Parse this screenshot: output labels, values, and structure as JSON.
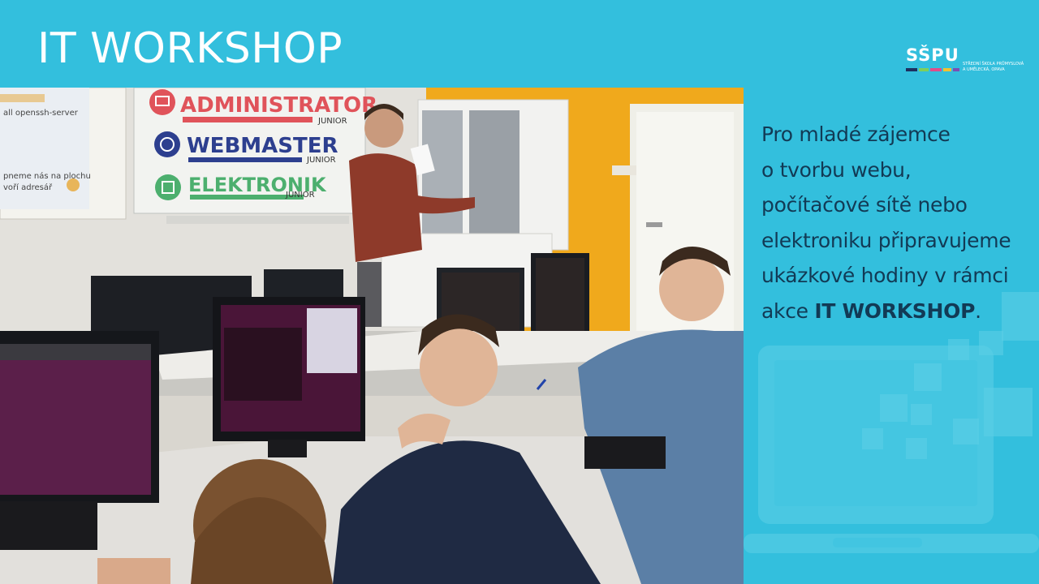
{
  "slide": {
    "title": "IT WORKSHOP"
  },
  "logo": {
    "mark": "SŠPU",
    "subtitle": "Střední škola průmyslová a umělecká, Opava"
  },
  "photo": {
    "banner_items": [
      "ADMINISTRATOR",
      "WEBMASTER",
      "ELEKTRONIK"
    ],
    "banner_sub": "JUNIOR",
    "projection_lines": [
      "all openssh-server",
      "pneme nás na plochu",
      "voří adresář"
    ]
  },
  "description": {
    "line1": "Pro mladé zájemce",
    "line2": "o tvorbu webu,",
    "line3": "počítačové sítě nebo",
    "line4": "elektroniku připravujeme",
    "line5": "ukázkové hodiny v rámci",
    "line6_prefix": "akce ",
    "line6_bold": "IT WORKSHOP",
    "line6_suffix": "."
  },
  "colors": {
    "header_bg": "#33bfdd",
    "text_dark": "#123a55",
    "admin_red": "#e0535a",
    "web_navy": "#2d3f8f",
    "elektro_green": "#4caf6e"
  }
}
